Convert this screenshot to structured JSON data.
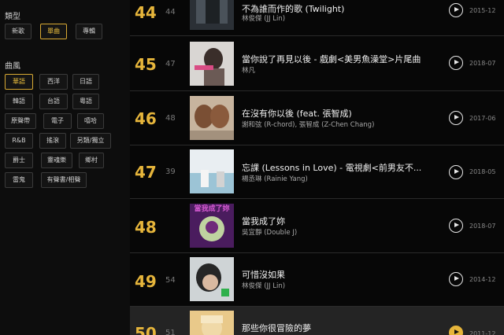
{
  "sidebar": {
    "type_title": "類型",
    "type_chips": [
      "新歌",
      "單曲",
      "專輯"
    ],
    "genre_title": "曲風",
    "genre_chips": [
      "華語",
      "西洋",
      "日語",
      "韓語",
      "台語",
      "粵語",
      "原聲帶",
      "電子",
      "嘻哈",
      "R&B",
      "搖滾",
      "另類/獨立",
      "爵士",
      "靈魂樂",
      "鄉村",
      "雷鬼",
      "有聲書/相聲"
    ]
  },
  "rows": [
    {
      "rank": "44",
      "prev": "44",
      "song": "不為誰而作的歌 (Twilight)",
      "artist": "林俊傑 (JJ Lin)",
      "date": "2015-12"
    },
    {
      "rank": "45",
      "prev": "47",
      "song": "當你說了再見以後 - 戲劇<美男魚澡堂>片尾曲",
      "artist": "林凡",
      "date": "2018-07"
    },
    {
      "rank": "46",
      "prev": "48",
      "song": "在沒有你以後 (feat. 張智成)",
      "artist": "謝和弦 (R-chord), 張智成 (Z-Chen Chang)",
      "date": "2017-06"
    },
    {
      "rank": "47",
      "prev": "39",
      "song": "忘課 (Lessons in Love) - 電視劇<前男友不...",
      "artist": "楊丞琳 (Rainie Yang)",
      "date": "2018-05"
    },
    {
      "rank": "48",
      "prev": "",
      "song": "當我成了妳",
      "artist": "吳宜靜 (Double J)",
      "date": "2018-07"
    },
    {
      "rank": "49",
      "prev": "54",
      "song": "可惜沒如果",
      "artist": "林俊傑 (JJ Lin)",
      "date": "2014-12"
    },
    {
      "rank": "50",
      "prev": "51",
      "song": "那些你很冒險的夢",
      "artist": "",
      "date": "2011-12"
    }
  ],
  "album_art_text": "當我成了妳",
  "colors": {
    "accent": "#e6b53b",
    "bg": "#070707"
  }
}
